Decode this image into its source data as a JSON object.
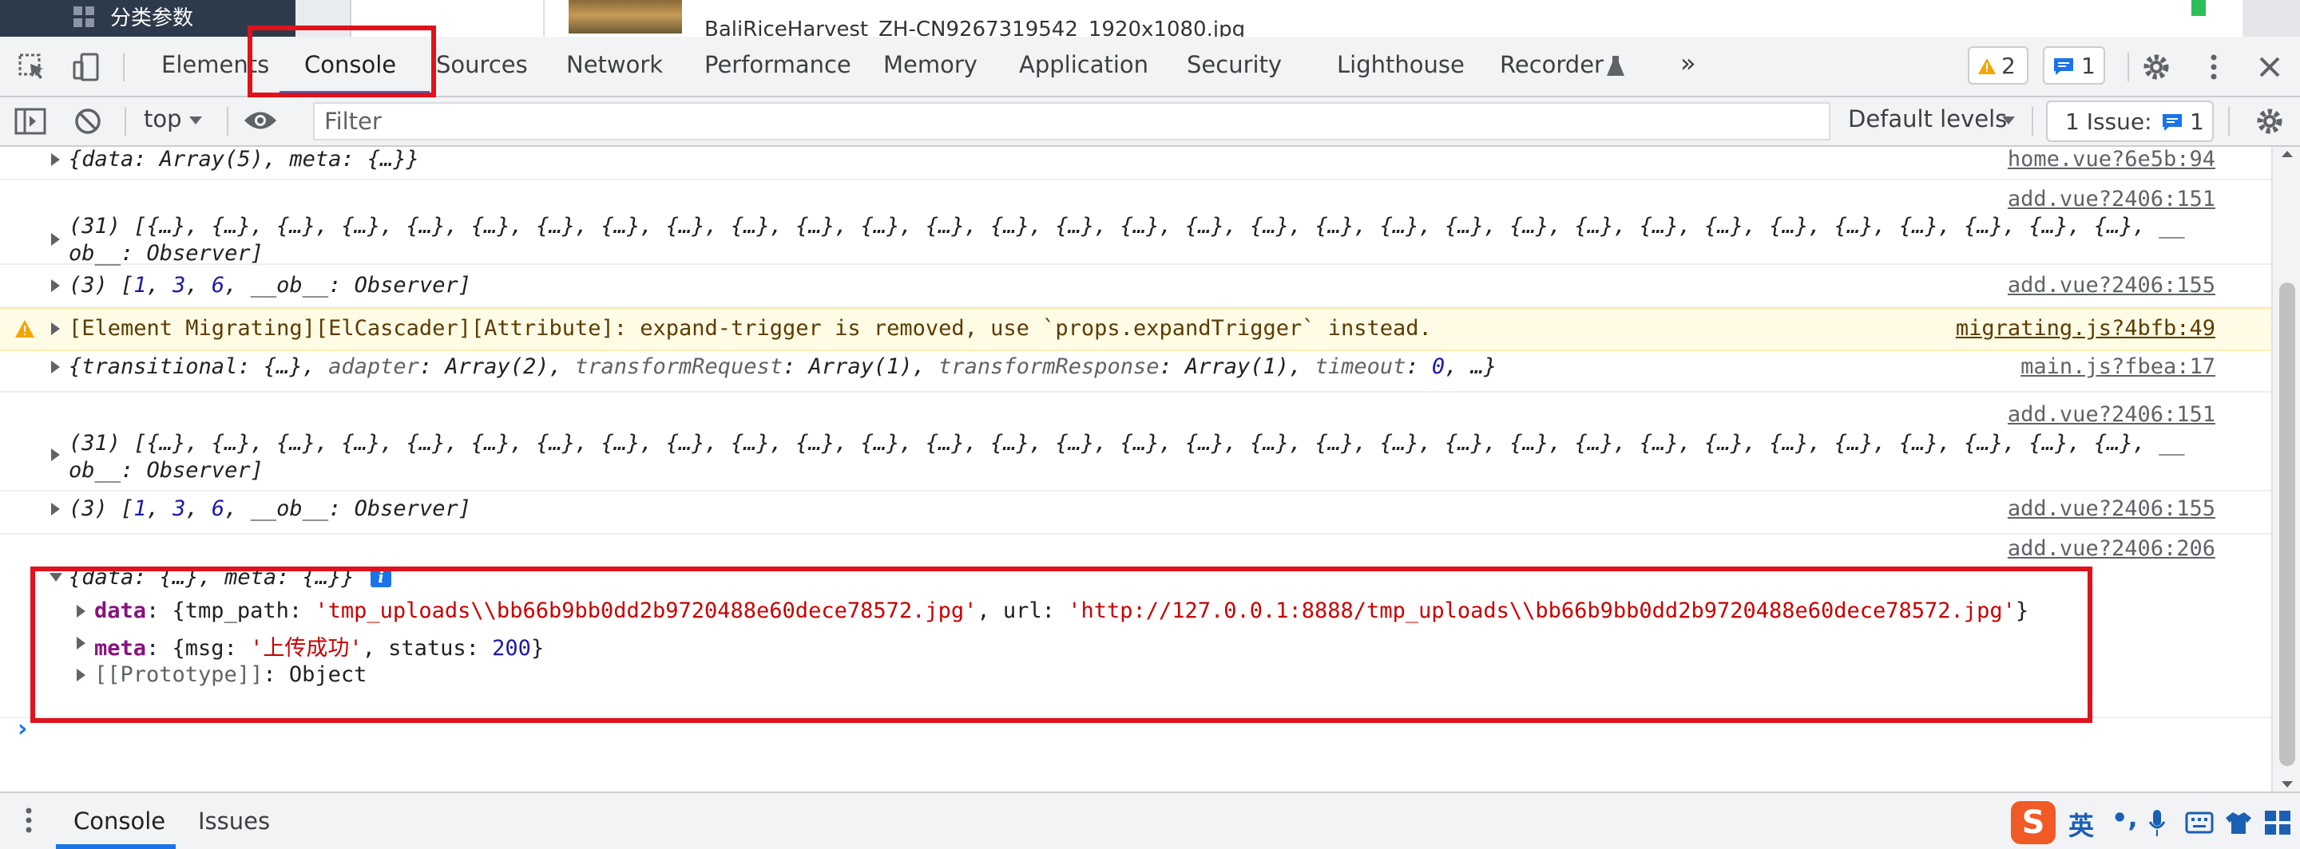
{
  "page_top": {
    "sidebar_label": "分类参数",
    "sidebar_icon": "grid-icon",
    "file_name": "BaliRiceHarvest_ZH-CN9267319542_1920x1080.jpg"
  },
  "devtools": {
    "tabs": [
      {
        "label": "Elements"
      },
      {
        "label": "Console",
        "active": true
      },
      {
        "label": "Sources"
      },
      {
        "label": "Network"
      },
      {
        "label": "Performance"
      },
      {
        "label": "Memory"
      },
      {
        "label": "Application"
      },
      {
        "label": "Security"
      },
      {
        "label": "Lighthouse"
      },
      {
        "label": "Recorder"
      }
    ],
    "more_tabs": "»",
    "warning_count": "2",
    "message_count": "1",
    "context": "top",
    "filter_placeholder": "Filter",
    "levels": "Default levels",
    "issues_label": "1 Issue:",
    "issues_count": "1"
  },
  "console": {
    "rows": [
      {
        "text": "{data: Array(5), meta: {…}}",
        "source": "home.vue?6e5b:94"
      },
      {
        "line1": "(31) [{…}, {…}, {…}, {…}, {…}, {…}, {…}, {…}, {…}, {…}, {…}, {…}, {…}, {…}, {…}, {…}, {…}, {…}, {…}, {…}, {…}, {…}, {…}, {…}, {…}, {…}, {…}, {…}, {…}, {…}, {…}, __",
        "line2": "ob__: Observer]",
        "source": "add.vue?2406:151"
      },
      {
        "prefix": "(3) [",
        "n1": "1",
        "n2": "3",
        "n3": "6",
        "suffix": ", __ob__: Observer]",
        "source": "add.vue?2406:155"
      },
      {
        "warning": "[Element Migrating][ElCascader][Attribute]: expand-trigger is removed, use `props.expandTrigger` instead.",
        "source": "migrating.js?4bfb:49"
      },
      {
        "t1": "{transitional: {…}, ",
        "k1": "adapter",
        "t2": ": Array(2), ",
        "k2": "transformRequest",
        "t3": ": Array(1), ",
        "k3": "transformResponse",
        "t4": ": Array(1), ",
        "k4": "timeout",
        "t5": ": ",
        "n": "0",
        "t6": ", …}",
        "source": "main.js?fbea:17"
      },
      {
        "line1": "(31) [{…}, {…}, {…}, {…}, {…}, {…}, {…}, {…}, {…}, {…}, {…}, {…}, {…}, {…}, {…}, {…}, {…}, {…}, {…}, {…}, {…}, {…}, {…}, {…}, {…}, {…}, {…}, {…}, {…}, {…}, {…}, __",
        "line2": "ob__: Observer]",
        "source": "add.vue?2406:151"
      },
      {
        "prefix": "(3) [",
        "n1": "1",
        "n2": "3",
        "n3": "6",
        "suffix": ", __ob__: Observer]",
        "source": "add.vue?2406:155"
      }
    ],
    "expanded": {
      "summary": "{data: {…}, meta: {…}}",
      "info_badge": "i",
      "source": "add.vue?2406:206",
      "data_key": "data",
      "data_open": ": {tmp_path: ",
      "tmp_path": "'tmp_uploads\\\\bb66b9bb0dd2b9720488e60dece78572.jpg'",
      "data_mid": ", url: ",
      "url": "'http://127.0.0.1:8888/tmp_uploads\\\\bb66b9bb0dd2b9720488e60dece78572.jpg'",
      "data_close": "}",
      "meta_key": "meta",
      "meta_open": ": {msg: ",
      "msg": "'上传成功'",
      "meta_mid": ", status: ",
      "status": "200",
      "meta_close": "}",
      "proto_key": "[[Prototype]]",
      "proto_val": ": Object"
    },
    "prompt": "›"
  },
  "drawer": {
    "tabs": [
      {
        "label": "Console",
        "active": true
      },
      {
        "label": "Issues"
      }
    ]
  },
  "ime": {
    "logo": "S",
    "lang": "英",
    "punct": "•,"
  },
  "colors": {
    "accent": "#1a73e8",
    "warning_bg": "#fffbe5",
    "string": "#c80000",
    "number": "#1a1aa6",
    "highlight_box": "#e0121c"
  }
}
